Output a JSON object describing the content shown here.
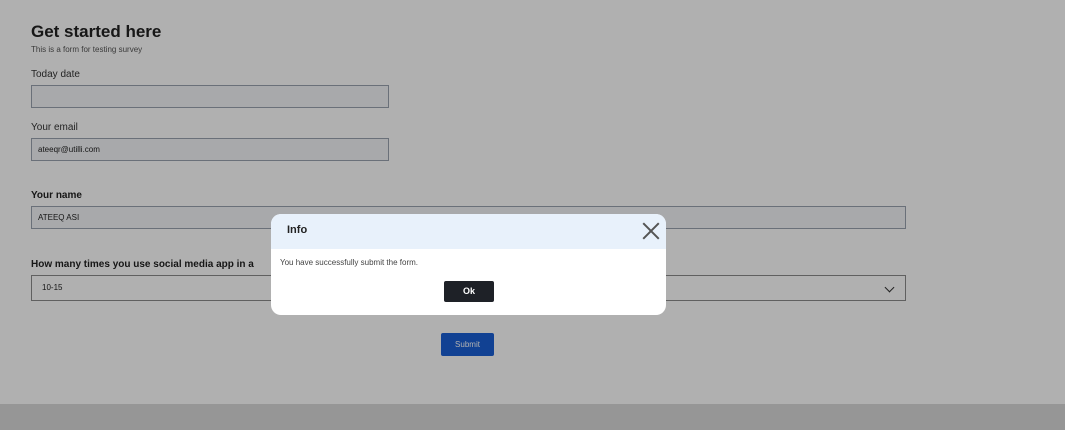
{
  "form": {
    "title": "Get started here",
    "subtitle": "This is a form for testing survey",
    "fields": {
      "today_date": {
        "label": "Today date",
        "value": ""
      },
      "email": {
        "label": "Your email",
        "value": "ateeqr@utilli.com"
      },
      "name": {
        "label": "Your name",
        "value": "ATEEQ ASI"
      },
      "social_media": {
        "label": "How many times you use social media app in a",
        "selected": "10-15"
      }
    },
    "submit_label": "Submit"
  },
  "modal": {
    "title": "Info",
    "message": "You have successfully submit the form.",
    "ok_label": "Ok"
  },
  "icons": {
    "close": "close-icon",
    "dropdown": "chevron-down-icon"
  },
  "colors": {
    "submit_button": "#1a5fd6",
    "ok_button": "#1e2127",
    "modal_header": "#e8f1fb",
    "overlay": "rgba(0,0,0,0.31)"
  }
}
